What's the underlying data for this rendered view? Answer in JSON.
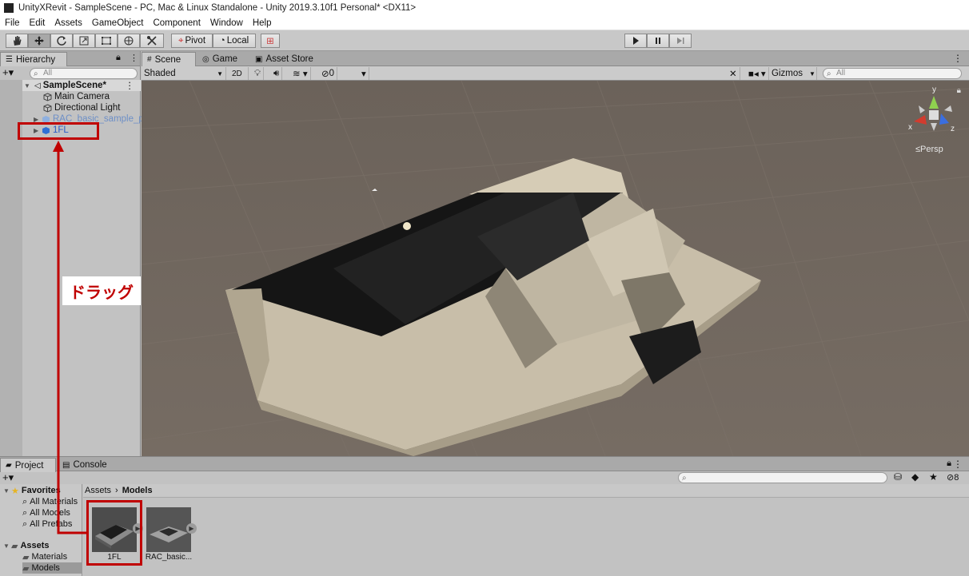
{
  "window": {
    "title": "UnityXRevit - SampleScene - PC, Mac & Linux Standalone - Unity 2019.3.10f1 Personal* <DX11>"
  },
  "menu": [
    "File",
    "Edit",
    "Assets",
    "GameObject",
    "Component",
    "Window",
    "Help"
  ],
  "toolbar": {
    "pivot_label": "Pivot",
    "local_label": "Local",
    "tools": [
      "hand-icon",
      "move-icon",
      "rotate-icon",
      "scale-icon",
      "rect-icon",
      "transform-icon",
      "custom-tool-icon"
    ]
  },
  "hierarchy": {
    "tab_label": "Hierarchy",
    "search_placeholder": "All",
    "scene_name": "SampleScene*",
    "items": [
      {
        "label": "Main Camera"
      },
      {
        "label": "Directional Light"
      },
      {
        "label": "RAC_basic_sample_pr"
      },
      {
        "label": "1FL"
      }
    ]
  },
  "scene_tabs": {
    "scene": "Scene",
    "game": "Game",
    "asset_store": "Asset Store"
  },
  "scene_toolbar": {
    "shading_mode": "Shaded",
    "mode_2d": "2D",
    "hidden_count": "0",
    "gizmos_label": "Gizmos",
    "search_placeholder": "All",
    "persp_label": "Persp"
  },
  "gizmo_axes": {
    "x": "x",
    "y": "y",
    "z": "z"
  },
  "project": {
    "tab_label": "Project",
    "console_label": "Console",
    "favorites_label": "Favorites",
    "favorites": [
      "All Materials",
      "All Models",
      "All Prefabs"
    ],
    "assets_label": "Assets",
    "asset_folders": [
      "Materials",
      "Models"
    ],
    "breadcrumb_root": "Assets",
    "breadcrumb_current": "Models",
    "hidden_count": "8",
    "assets": [
      {
        "label": "1FL"
      },
      {
        "label": "RAC_basic..."
      }
    ]
  },
  "annotation": {
    "drag_label": "ドラッグ",
    "color": "#c00000"
  },
  "colors": {
    "scene_bg": "#6f655d",
    "panel_bg": "#c2c2c2",
    "selection_blue": "#3a72d9"
  }
}
